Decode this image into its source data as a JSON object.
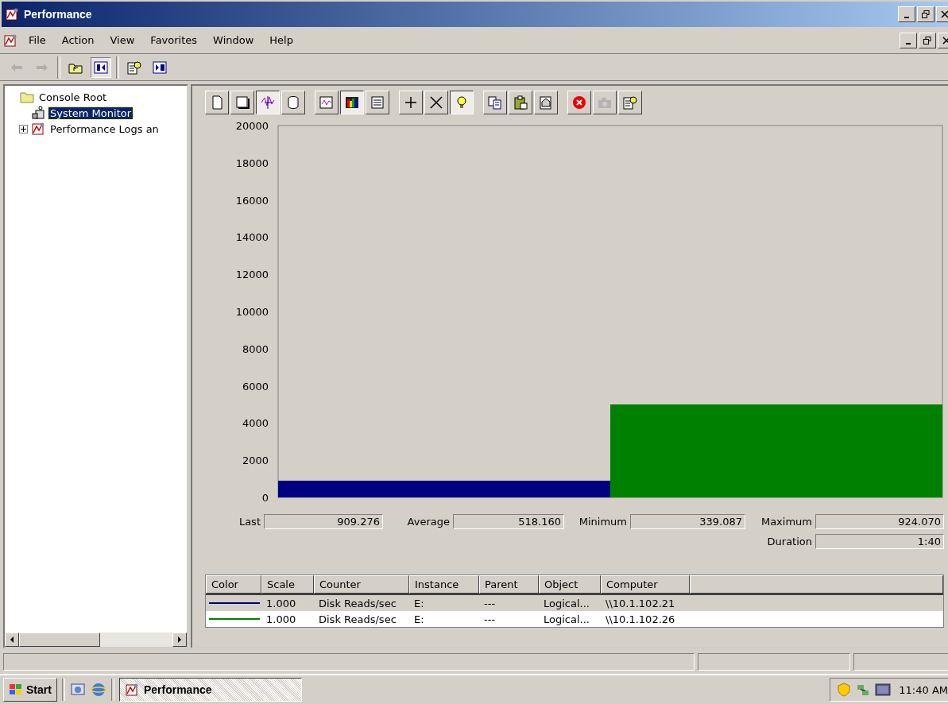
{
  "window": {
    "title": "Performance"
  },
  "menu": [
    "File",
    "Action",
    "View",
    "Favorites",
    "Window",
    "Help"
  ],
  "toolbar": [
    {
      "kind": "back",
      "disabled": true
    },
    {
      "kind": "forward",
      "disabled": true
    },
    {
      "kind": "up",
      "disabled": false
    },
    {
      "kind": "tree",
      "disabled": false
    },
    {
      "kind": "help",
      "disabled": false
    },
    {
      "kind": "panel",
      "disabled": false
    }
  ],
  "tree": [
    {
      "label": "Console Root",
      "kind": "folder",
      "expanded": true,
      "selected": false,
      "children": [
        {
          "label": "System Monitor",
          "kind": "monitor",
          "selected": true
        },
        {
          "label": "Performance Logs an",
          "kind": "logs",
          "expanded": false,
          "selected": false
        }
      ]
    }
  ],
  "monitor_toolbar": [
    {
      "kind": "new",
      "pressed": false,
      "disabled": false
    },
    {
      "kind": "clear",
      "pressed": false,
      "disabled": false
    },
    {
      "kind": "current",
      "pressed": true,
      "disabled": false
    },
    {
      "kind": "log",
      "pressed": false,
      "disabled": false
    },
    {
      "kind": "sep"
    },
    {
      "kind": "graph",
      "pressed": false,
      "disabled": false
    },
    {
      "kind": "histogram",
      "pressed": true,
      "disabled": false
    },
    {
      "kind": "report",
      "pressed": false,
      "disabled": false
    },
    {
      "kind": "sep"
    },
    {
      "kind": "add",
      "pressed": false,
      "disabled": false
    },
    {
      "kind": "delete",
      "pressed": false,
      "disabled": false
    },
    {
      "kind": "highlight",
      "pressed": true,
      "disabled": false
    },
    {
      "kind": "sep"
    },
    {
      "kind": "copy",
      "pressed": false,
      "disabled": false
    },
    {
      "kind": "paste",
      "pressed": false,
      "disabled": false
    },
    {
      "kind": "properties",
      "pressed": false,
      "disabled": false
    },
    {
      "kind": "sep"
    },
    {
      "kind": "freeze",
      "pressed": false,
      "disabled": false
    },
    {
      "kind": "update",
      "pressed": false,
      "disabled": true
    },
    {
      "kind": "help",
      "pressed": false,
      "disabled": false
    }
  ],
  "chart_data": {
    "type": "bar",
    "ylim": [
      0,
      20000
    ],
    "yticks": [
      0,
      2000,
      4000,
      6000,
      8000,
      10000,
      12000,
      14000,
      16000,
      18000,
      20000
    ],
    "series": [
      {
        "color": "#000080",
        "values": [
          900
        ]
      },
      {
        "color": "#008000",
        "values": [
          5000
        ]
      }
    ]
  },
  "stats": [
    {
      "label": "Last",
      "value": "909.276"
    },
    {
      "label": "Average",
      "value": "518.160"
    },
    {
      "label": "Minimum",
      "value": "339.087"
    },
    {
      "label": "Maximum",
      "value": "924.070"
    },
    {
      "label": "Duration",
      "value": "1:40"
    }
  ],
  "legend": {
    "columns": [
      "Color",
      "Scale",
      "Counter",
      "Instance",
      "Parent",
      "Object",
      "Computer"
    ],
    "rows": [
      {
        "color": "#000080",
        "selected": true,
        "cells": [
          "",
          "1.000",
          "Disk Reads/sec",
          "E:",
          "---",
          "Logical...",
          "\\\\10.1.102.21"
        ]
      },
      {
        "color": "#008000",
        "selected": false,
        "cells": [
          "",
          "1.000",
          "Disk Reads/sec",
          "E:",
          "---",
          "Logical...",
          "\\\\10.1.102.26"
        ]
      }
    ]
  },
  "taskbar": {
    "start": "Start",
    "tasks": [
      {
        "label": "Performance",
        "selected": true
      }
    ],
    "clock": "11:40 AM"
  }
}
